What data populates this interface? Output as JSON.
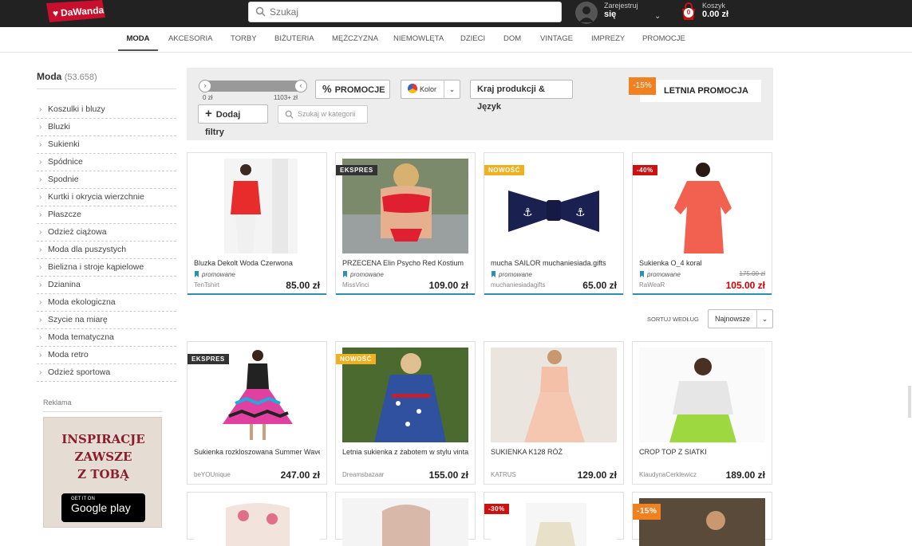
{
  "header": {
    "logo_text": "DaWanda",
    "search_placeholder": "Szukaj",
    "account_line1": "Zarejestruj",
    "account_line2": "się",
    "cart_label": "Koszyk",
    "cart_total": "0.00 zł",
    "cart_count": "0"
  },
  "nav": [
    {
      "label": "MODA",
      "active": true
    },
    {
      "label": "AKCESORIA"
    },
    {
      "label": "TORBY"
    },
    {
      "label": "BIŻUTERIA"
    },
    {
      "label": "MĘŻCZYZNA"
    },
    {
      "label": "NIEMOWLĘTA"
    },
    {
      "label": "DZIECI"
    },
    {
      "label": "DOM"
    },
    {
      "label": "VINTAGE"
    },
    {
      "label": "IMPREZY"
    },
    {
      "label": "PROMOCJE"
    }
  ],
  "sidebar": {
    "title": "Moda",
    "count": "(53.658)",
    "categories": [
      "Koszulki i bluzy",
      "Bluzki",
      "Sukienki",
      "Spódnice",
      "Spodnie",
      "Kurtki i okrycia wierzchnie",
      "Płaszcze",
      "Odzież ciążowa",
      "Moda dla puszystych",
      "Bielizna i stroje kąpielowe",
      "Dzianina",
      "Moda ekologiczna",
      "Szycie na miarę",
      "Moda tematyczna",
      "Moda retro",
      "Odzież sportowa"
    ],
    "ad_label": "Reklama",
    "ad_text": "INSPIRACJE\nZAWSZE\nZ TOBĄ",
    "ad_store_small": "GET IT ON",
    "ad_store_big": "Google play"
  },
  "filters": {
    "range_min": "0 zł",
    "range_max": "1103+ zł",
    "promo_button": "PROMOCJE",
    "color_button": "Kolor",
    "origin_button": "Kraj produkcji & Język",
    "add_filters": "Dodaj filtry",
    "category_search_placeholder": "Szukaj w kategorii",
    "banner_text": "LETNIA PROMOCJA",
    "banner_badge": "-15%"
  },
  "sort": {
    "label": "SORTUJ WEDŁUG",
    "value": "Najnowsze"
  },
  "row1": [
    {
      "title": "Bluzka Dekolt Woda Czerwona",
      "promoted": "promowane",
      "seller": "TenTshirt",
      "price": "85.00 zł",
      "badge": ""
    },
    {
      "title": "PRZECENA Elin Psycho Red Kostium",
      "promoted": "promowane",
      "seller": "MissVinci",
      "price": "109.00 zł",
      "badge": "EKSPRES"
    },
    {
      "title": "mucha SAILOR muchaniesiada.gifts",
      "promoted": "promowane",
      "seller": "muchaniesiadagifts",
      "price": "65.00 zł",
      "badge": "NOWOŚĆ"
    },
    {
      "title": "Sukienka O_4 koral",
      "promoted": "promowane",
      "seller": "RaWeaR",
      "price": "105.00 zł",
      "old_price": "175.00 zł",
      "badge": "-40%"
    }
  ],
  "row2": [
    {
      "title": "Sukienka rozkloszowana Summer Waves",
      "seller": "beYOUnique",
      "price": "247.00 zł",
      "badge": "EKSPRES"
    },
    {
      "title": "Letnia sukienka z żabotem w stylu vintage",
      "seller": "Dreamsbazaar",
      "price": "155.00 zł",
      "badge": "NOWOŚĆ"
    },
    {
      "title": "SUKIENKA K128 RÓŻ",
      "seller": "KATRUS",
      "price": "129.00 zł",
      "badge": ""
    },
    {
      "title": "CROP TOP Z SIATKI",
      "seller": "KlaudynaCerklewicz",
      "price": "189.00 zł",
      "badge": ""
    }
  ],
  "row3": [
    {
      "badge": ""
    },
    {
      "badge": ""
    },
    {
      "badge": "-30%"
    },
    {
      "badge": "-15%"
    }
  ],
  "colors": {
    "accent_blue": "#2a8fb0",
    "brand_red": "#c8102e",
    "sale_red": "#cc0000",
    "promo_orange": "#f08020"
  }
}
